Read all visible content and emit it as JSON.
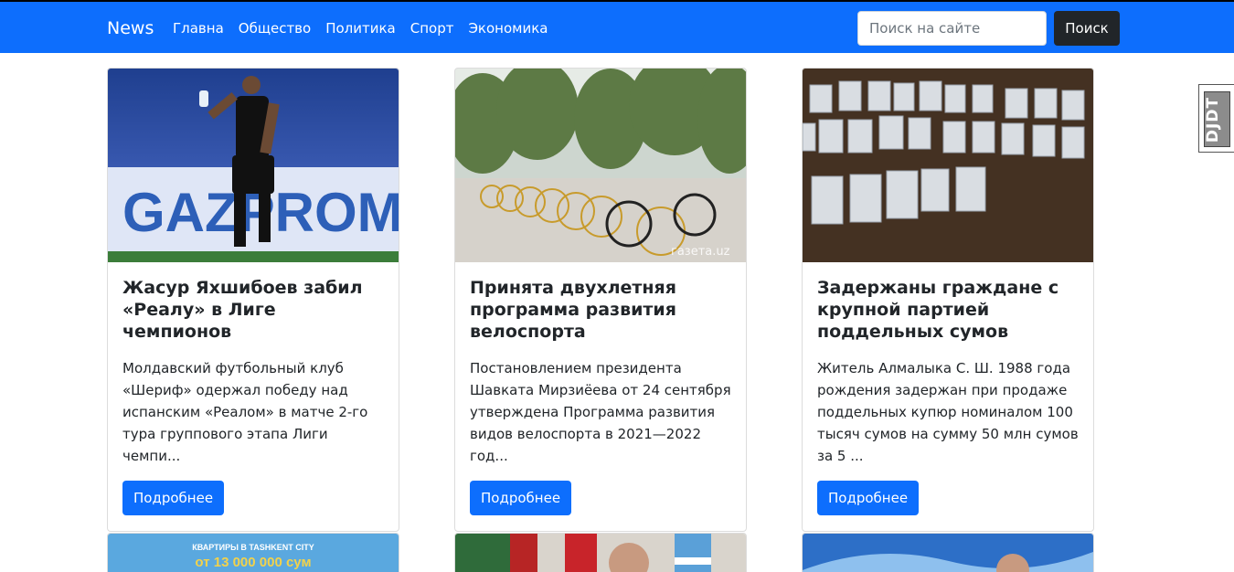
{
  "navbar": {
    "brand": "News",
    "links": [
      "Главна",
      "Общество",
      "Политика",
      "Спорт",
      "Экономика"
    ],
    "search_placeholder": "Поиск на сайте",
    "search_button": "Поиск"
  },
  "extension_badge": "DJDT",
  "cards": [
    {
      "title": "Жасур Яхшибоев забил «Реалу» в Лиге чемпионов",
      "text": "Молдавский футбольный клуб «Шериф» одержал победу над испанским «Реалом» в матче 2-го тура группового этапа Лиги чемпи...",
      "button": "Подробнее",
      "image_banner_text": "GAZPROM"
    },
    {
      "title": "Принята двухлетняя программа развития велоспорта",
      "text": "Постановлением президента Шавката Мирзиёева от 24 сентября утверждена Программа развития видов велоспорта в 2021—2022 год...",
      "button": "Подробнее",
      "image_watermark": "газета.uz"
    },
    {
      "title": "Задержаны граждане с крупной партией поддельных сумов",
      "text": "Житель Алмалыка С. Ш. 1988 года рождения задержан при продаже поддельных купюр номиналом 100 тысяч сумов на сумму 50 млн сумов за 5 ...",
      "button": "Подробнее"
    }
  ],
  "row2": {
    "ad_top": "КВАРТИРЫ В TASHKENT CITY",
    "ad_price": "от 13 000 000 сум"
  }
}
